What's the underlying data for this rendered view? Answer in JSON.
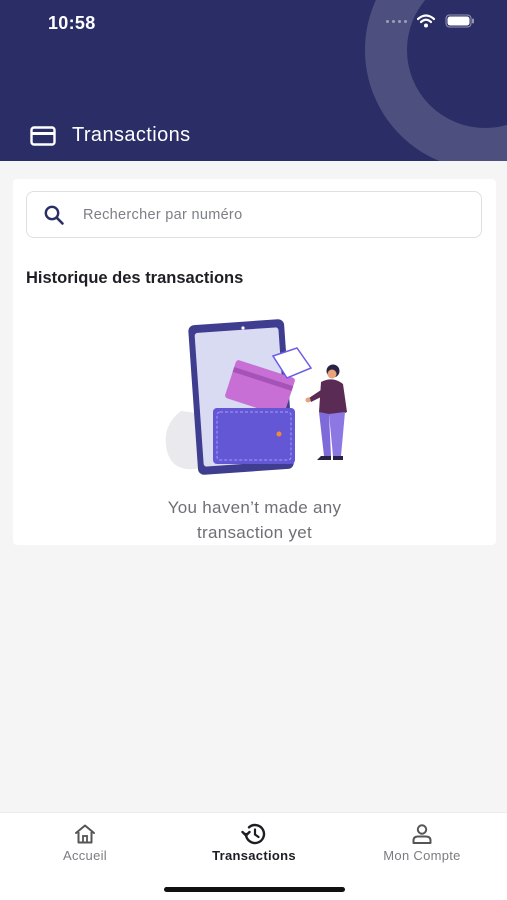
{
  "status_bar": {
    "time": "10:58"
  },
  "header": {
    "title": "Transactions",
    "title_icon": "credit-card-icon"
  },
  "search": {
    "placeholder": "Rechercher par numéro",
    "value": ""
  },
  "history": {
    "title": "Historique des transactions",
    "empty_line1": "You haven’t made any",
    "empty_line2": "transaction yet"
  },
  "bottom_nav": {
    "items": [
      {
        "label": "Accueil",
        "icon": "home-icon",
        "active": false
      },
      {
        "label": "Transactions",
        "icon": "history-icon",
        "active": true
      },
      {
        "label": "Mon Compte",
        "icon": "user-icon",
        "active": false
      }
    ]
  },
  "colors": {
    "header_bg": "#2b2e66",
    "accent_purple": "#6c5ce7",
    "background": "#f5f5f6"
  }
}
